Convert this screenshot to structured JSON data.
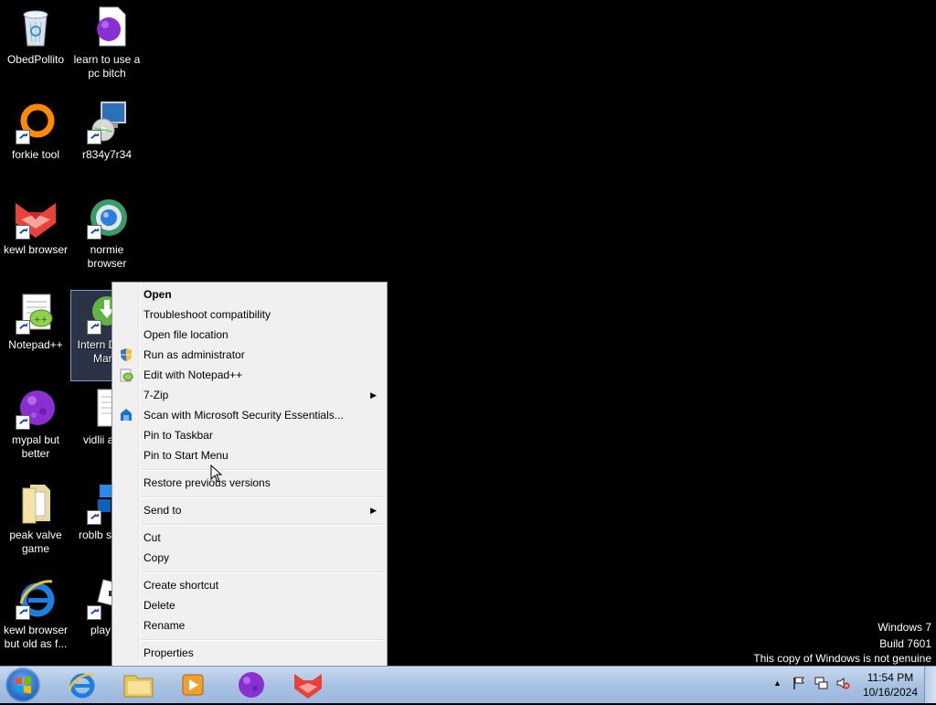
{
  "desktop": {
    "icons": [
      {
        "label": "ObedPollito",
        "icon": "recycle-bin-icon"
      },
      {
        "label": "learn to use a pc bitch",
        "icon": "purple-orb-document-icon"
      },
      {
        "label": "forkie tool",
        "icon": "orange-ring-icon"
      },
      {
        "label": "r834y7r34",
        "icon": "computer-disc-installer-icon"
      },
      {
        "label": "kewl browser",
        "icon": "red-fox-browser-icon"
      },
      {
        "label": "normie browser",
        "icon": "globe-browser-icon"
      },
      {
        "label": "Notepad++",
        "icon": "notepad-plus-plus-icon"
      },
      {
        "label": "Intern Down Mana",
        "icon": "internet-download-manager-icon"
      },
      {
        "label": "mypal but better",
        "icon": "purple-planet-icon"
      },
      {
        "label": "vidlii a ips",
        "icon": "text-document-icon"
      },
      {
        "label": "peak valve game",
        "icon": "folder-icon"
      },
      {
        "label": "roblb studio",
        "icon": "roblox-studio-icon"
      },
      {
        "label": "kewl browser but old as f...",
        "icon": "internet-explorer-icon"
      },
      {
        "label": "play ro",
        "icon": "roblox-player-icon"
      }
    ]
  },
  "context_menu": {
    "items": [
      {
        "label": "Open",
        "bold": true
      },
      {
        "label": "Troubleshoot compatibility"
      },
      {
        "label": "Open file location"
      },
      {
        "label": "Run as administrator",
        "icon": "uac-shield-icon"
      },
      {
        "label": "Edit with Notepad++",
        "icon": "notepad-plus-plus-icon"
      },
      {
        "label": "7-Zip",
        "submenu": true
      },
      {
        "label": "Scan with Microsoft Security Essentials...",
        "icon": "security-essentials-icon"
      },
      {
        "label": "Pin to Taskbar"
      },
      {
        "label": "Pin to Start Menu"
      },
      {
        "label": "Restore previous versions"
      },
      {
        "label": "Send to",
        "submenu": true
      },
      {
        "label": "Cut"
      },
      {
        "label": "Copy"
      },
      {
        "label": "Create shortcut"
      },
      {
        "label": "Delete"
      },
      {
        "label": "Rename"
      },
      {
        "label": "Properties"
      }
    ],
    "submenu_arrow": "▶"
  },
  "watermark": {
    "line1": "Windows 7",
    "line2": "Build 7601",
    "line3": "This copy of Windows is not genuine"
  },
  "taskbar": {
    "pinned": [
      "internet-explorer-icon",
      "windows-explorer-icon",
      "media-player-icon",
      "purple-planet-icon",
      "red-fox-browser-icon"
    ],
    "tray_arrow": "▲",
    "time": "11:54 PM",
    "date": "10/16/2024"
  },
  "colors": {
    "desktop_bg": "#000000",
    "menu_bg": "#f0f0f0",
    "taskbar": "#a9c2e2"
  }
}
